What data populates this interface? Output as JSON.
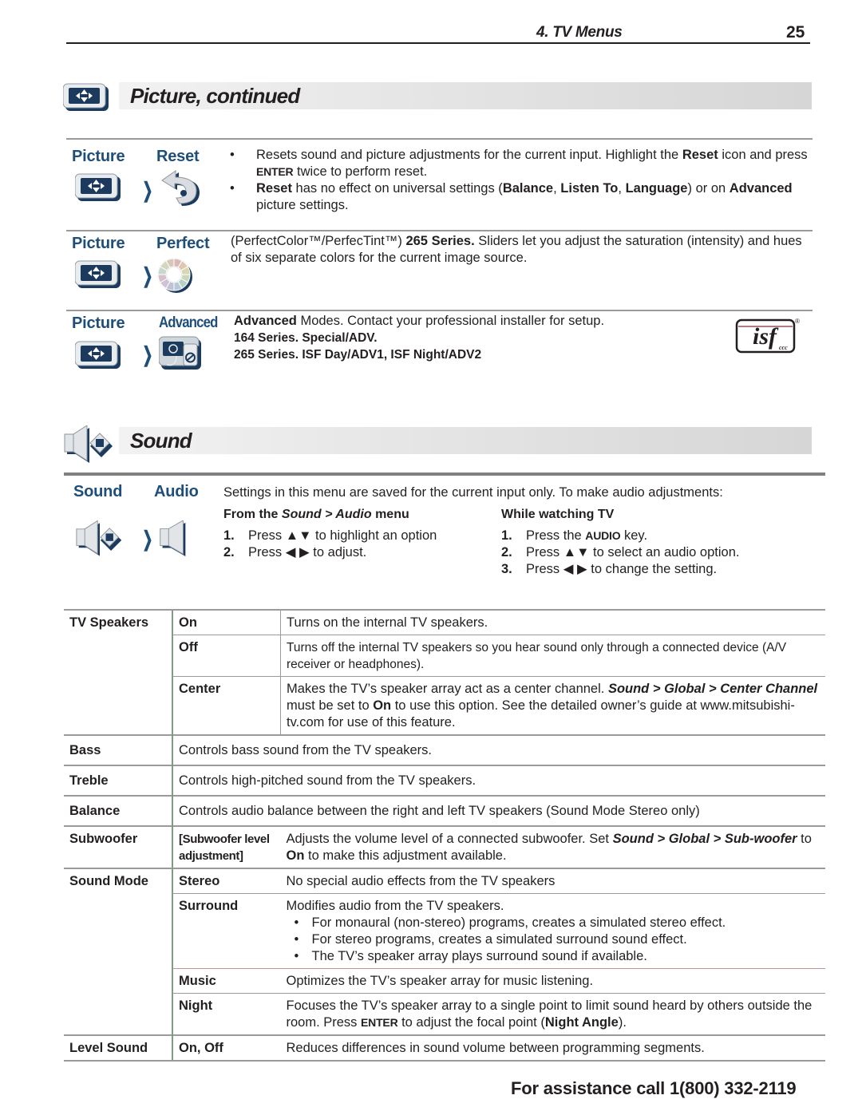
{
  "header": {
    "chapter": "4.  TV Menus",
    "page_number": "25"
  },
  "picture_section": {
    "title": "Picture, continued",
    "icon": "picture-menu-icon",
    "entries": [
      {
        "menu": "Picture",
        "item": "Reset",
        "item_icon": "reset-arrow-icon",
        "bullets": [
          [
            "Resets sound and picture adjustments for the current input.  Highlight the ",
            {
              "b": "Reset"
            },
            " icon and press ",
            {
              "caps": "ENTER"
            },
            " twice to perform reset."
          ],
          [
            {
              "b": "Reset"
            },
            " has no effect on universal settings (",
            {
              "b": "Balance"
            },
            ", ",
            {
              "b": "Listen To"
            },
            ", ",
            {
              "b": "Language"
            },
            ") or on ",
            {
              "b": "Advanced"
            },
            " picture settings."
          ]
        ]
      },
      {
        "menu": "Picture",
        "item": "Perfect",
        "item_icon": "color-wheel-icon",
        "text": [
          "(PerfectColor™/PerfecTint™)  ",
          {
            "b": "265 Series."
          },
          "  Sliders let you adjust the saturation (intensity) and hues of six separate colors for the current image source."
        ]
      },
      {
        "menu": "Picture",
        "item": "Advanced",
        "item_icon": "advanced-settings-icon",
        "lines": [
          [
            {
              "b": "Advanced"
            },
            " Modes.  Contact your professional installer for setup."
          ],
          [
            {
              "b": "164 Series.  Special/ADV."
            }
          ],
          [
            {
              "b": "265 Series.  ISF Day/ADV1, ISF Night/ADV2"
            }
          ]
        ],
        "logo": {
          "name": "isf-logo",
          "text": "isf",
          "sub": "ccc",
          "mark": "®"
        }
      }
    ]
  },
  "sound_section": {
    "title": "Sound",
    "icon": "sound-menu-icon",
    "audio": {
      "menu": "Sound",
      "item": "Audio",
      "item_icon": "speaker-icon",
      "intro": "Settings in this menu are saved for the current input only.  To make audio adjustments:",
      "col1": {
        "heading": [
          "From the ",
          {
            "bi": "Sound > Audio"
          },
          " menu"
        ],
        "steps": [
          {
            "n": "1.",
            "t": [
              "Press ▲▼ to highlight an option"
            ]
          },
          {
            "n": "2.",
            "t": [
              "Press ◀ ▶ to adjust."
            ]
          }
        ]
      },
      "col2": {
        "heading": [
          "While watching TV"
        ],
        "steps": [
          {
            "n": "1.",
            "t": [
              "Press the ",
              {
                "caps": "AUDIO"
              },
              " key."
            ]
          },
          {
            "n": "2.",
            "t": [
              "Press ▲▼ to select an audio option."
            ]
          },
          {
            "n": "3.",
            "t": [
              "Press ◀ ▶ to change the setting."
            ]
          }
        ]
      }
    },
    "table": [
      {
        "setting": "TV Speakers",
        "options": [
          {
            "option": "On",
            "desc": [
              "Turns on the internal TV speakers."
            ]
          },
          {
            "option": "Off",
            "desc": [
              "Turns off the internal TV speakers so you hear sound only through a connected device (A/V receiver or headphones)."
            ]
          },
          {
            "option": "Center",
            "desc": [
              "Makes the TV’s speaker array act as a center channel.  ",
              {
                "bi": "Sound > Global > Center Channel"
              },
              " must be set to ",
              {
                "b": "On"
              },
              " to use this option.  See the detailed owner’s guide at www.mitsubishi-tv.com for use of this feature."
            ]
          }
        ]
      },
      {
        "setting": "Bass",
        "desc": [
          "Controls bass sound from the TV speakers."
        ]
      },
      {
        "setting": "Treble",
        "desc": [
          "Controls high-pitched sound from the TV speakers."
        ]
      },
      {
        "setting": "Balance",
        "desc": [
          "Controls audio balance between the right and left TV speakers (Sound Mode Stereo only)"
        ]
      },
      {
        "setting": "Subwoofer",
        "options": [
          {
            "option": "[Subwoofer level adjustment]",
            "desc": [
              "Adjusts the volume level of a connected subwoofer.  Set ",
              {
                "bi": "Sound > Global > Sub-woofer"
              },
              " to ",
              {
                "b": "On"
              },
              " to make this adjustment available."
            ]
          }
        ]
      },
      {
        "setting": "Sound Mode",
        "options": [
          {
            "option": "Stereo",
            "desc": [
              "No special audio effects from the TV speakers"
            ]
          },
          {
            "option": "Surround",
            "desc": [
              "Modifies audio from the TV speakers."
            ],
            "bullets": [
              "For monaural (non-stereo) programs, creates a simulated stereo effect.",
              "For stereo programs, creates a simulated surround sound effect.",
              "The TV’s speaker array plays surround sound if available."
            ]
          },
          {
            "option": "Music",
            "desc": [
              "Optimizes the TV’s speaker array for music listening."
            ]
          },
          {
            "option": "Night",
            "desc": [
              "Focuses the TV’s speaker array to a single point to limit sound heard by others outside the room.  Press ",
              {
                "caps": "ENTER"
              },
              " to adjust the focal point (",
              {
                "b": "Night Angle"
              },
              ")."
            ]
          }
        ]
      },
      {
        "setting": "Level Sound",
        "options": [
          {
            "option": "On, Off",
            "desc": [
              "Reduces differences in sound volume between programming segments."
            ]
          }
        ]
      }
    ]
  },
  "footer": {
    "assistance": "For assistance call 1(800) 332-2119"
  },
  "colors": {
    "menu_label": "#1f4e79",
    "icon_navy": "#1c3a5e",
    "band_light": "#f2f2f2",
    "band_dark": "#d6d6d6",
    "rule_gray": "#9a9a9a",
    "table_divider_green": "#7f9b86",
    "text": "#231f20"
  }
}
